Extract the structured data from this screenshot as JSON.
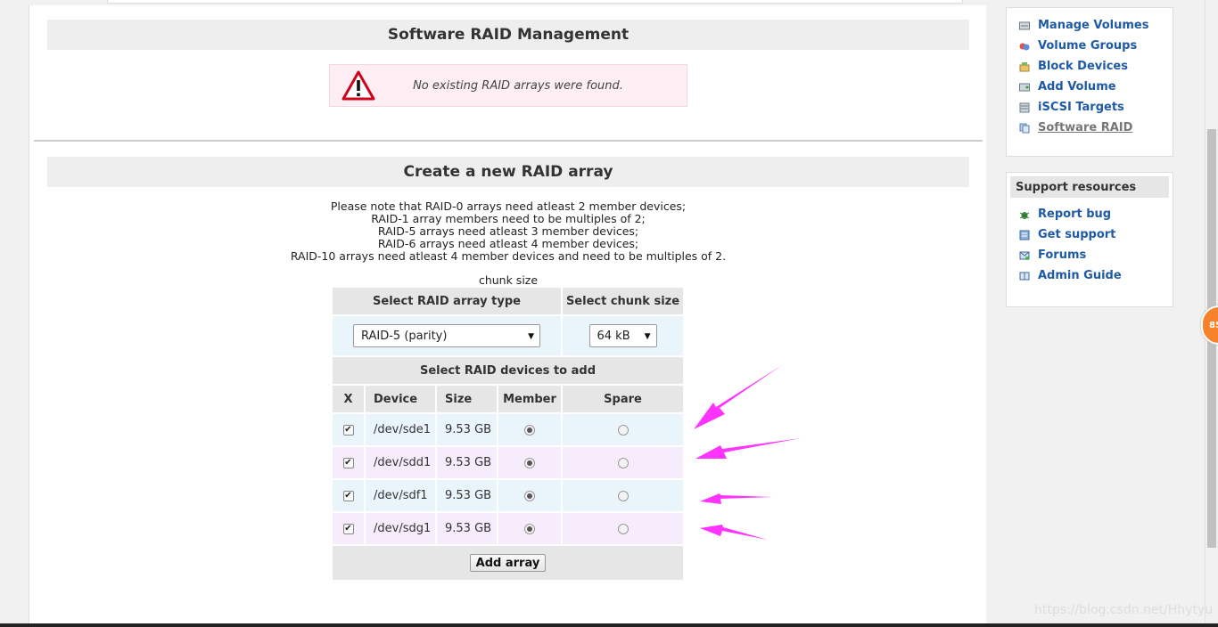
{
  "main": {
    "management_title": "Software RAID Management",
    "alert_message": "No existing RAID arrays were found.",
    "create_title": "Create a new RAID array",
    "notes": [
      "Please note that RAID-0 arrays need atleast 2 member devices;",
      "RAID-1 array members need to be multiples of 2;",
      "RAID-5 arrays need atleast 3 member devices;",
      "RAID-6 arrays need atleast 4 member devices;",
      "RAID-10 arrays need atleast 4 member devices and need to be multiples of 2."
    ],
    "chunk_caption": "chunk size",
    "form": {
      "raid_type_header": "Select RAID array type",
      "chunk_size_header": "Select chunk size",
      "raid_type_value": "RAID-5 (parity)",
      "chunk_size_value": "64 kB",
      "devices_header": "Select RAID devices to add",
      "columns": [
        "X",
        "Device",
        "Size",
        "Member",
        "Spare"
      ],
      "devices": [
        {
          "device": "/dev/sde1",
          "size": "9.53 GB",
          "checked": true,
          "role": "member"
        },
        {
          "device": "/dev/sdd1",
          "size": "9.53 GB",
          "checked": true,
          "role": "member"
        },
        {
          "device": "/dev/sdf1",
          "size": "9.53 GB",
          "checked": true,
          "role": "member"
        },
        {
          "device": "/dev/sdg1",
          "size": "9.53 GB",
          "checked": true,
          "role": "member"
        }
      ],
      "add_button": "Add array"
    }
  },
  "sidebar": {
    "nav_items": [
      {
        "label": "Manage Volumes",
        "icon": "drive-icon"
      },
      {
        "label": "Volume Groups",
        "icon": "volume-group-icon"
      },
      {
        "label": "Block Devices",
        "icon": "block-devices-icon"
      },
      {
        "label": "Add Volume",
        "icon": "add-volume-icon"
      },
      {
        "label": "iSCSI Targets",
        "icon": "iscsi-icon"
      },
      {
        "label": "Software RAID",
        "icon": "raid-icon",
        "current": true
      }
    ],
    "support_title": "Support resources",
    "support_items": [
      {
        "label": "Report bug",
        "icon": "bug-icon"
      },
      {
        "label": "Get support",
        "icon": "support-icon"
      },
      {
        "label": "Forums",
        "icon": "forum-icon"
      },
      {
        "label": "Admin Guide",
        "icon": "book-icon"
      }
    ]
  },
  "badge": {
    "text": "85"
  },
  "watermark": "https://blog.csdn.net/Hhytyu",
  "colors": {
    "link": "#1f5aa6",
    "header_bg": "#eeeeee",
    "alert_bg": "#fdeef4",
    "row_blue": "#eaf4fb",
    "row_pink": "#f7ecfb",
    "annotation_arrow": "#ff33ff",
    "badge": "#f7822b"
  }
}
